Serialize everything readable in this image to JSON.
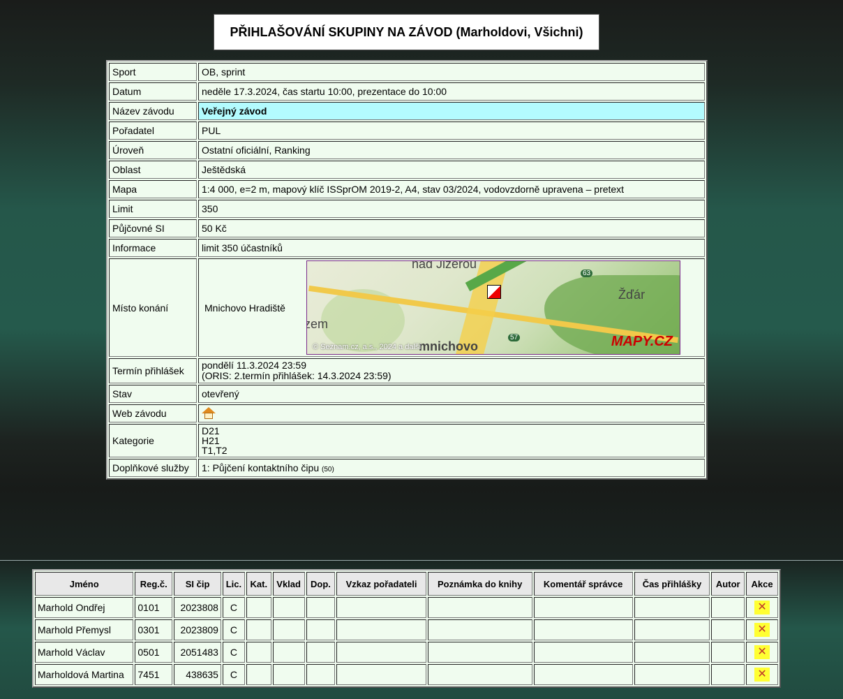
{
  "title": "PŘIHLAŠOVÁNÍ SKUPINY NA ZÁVOD (Marholdovi, Všichni)",
  "info": {
    "sport_label": "Sport",
    "sport": "OB, sprint",
    "datum_label": "Datum",
    "datum": "neděle 17.3.2024, čas startu 10:00, prezentace do 10:00",
    "nazev_label": "Název závodu",
    "nazev": "Veřejný závod",
    "poradatel_label": "Pořadatel",
    "poradatel": "PUL",
    "uroven_label": "Úroveň",
    "uroven": "Ostatní oficiální, Ranking",
    "oblast_label": "Oblast",
    "oblast": "Ještědská",
    "mapa_label": "Mapa",
    "mapa": "1:4 000, e=2 m, mapový klíč ISSprOM 2019-2, A4, stav 03/2024, vodovzdorně upravena – pretext",
    "limit_label": "Limit",
    "limit": "350",
    "si_label": "Půjčovné SI",
    "si": "50 Kč",
    "informace_label": "Informace",
    "informace": "limit 350 účastníků",
    "misto_label": "Místo konání",
    "misto": "Mnichovo Hradiště",
    "termin_label": "Termín přihlášek",
    "termin_line1": "pondělí 11.3.2024 23:59",
    "termin_line2": "(ORIS: 2.termín přihlášek: 14.3.2024 23:59)",
    "stav_label": "Stav",
    "stav": "otevřený",
    "web_label": "Web závodu",
    "kategorie_label": "Kategorie",
    "kategorie": [
      "D21",
      "H21",
      "T1,T2"
    ],
    "sluzby_label": "Doplňkové služby",
    "sluzby": "1: Půjčení kontaktního čipu",
    "sluzby_small": "(50)"
  },
  "map": {
    "label_top": "nad Jizerou",
    "label_left": "zem",
    "label_right": "Žďár",
    "label_bottom": "mnichovo",
    "road_63": "63",
    "road_57": "57",
    "copyright": "© Seznam.cz, a.s., 2024 a další",
    "brand": "MAPY.CZ"
  },
  "table": {
    "headers": [
      "Jméno",
      "Reg.č.",
      "SI čip",
      "Lic.",
      "Kat.",
      "Vklad",
      "Dop.",
      "Vzkaz pořadateli",
      "Poznámka do knihy",
      "Komentář správce",
      "Čas přihlášky",
      "Autor",
      "Akce"
    ],
    "rows": [
      {
        "name": "Marhold Ondřej",
        "reg": "0101",
        "si": "2023808",
        "lic": "C"
      },
      {
        "name": "Marhold Přemysl",
        "reg": "0301",
        "si": "2023809",
        "lic": "C"
      },
      {
        "name": "Marhold Václav",
        "reg": "0501",
        "si": "2051483",
        "lic": "C"
      },
      {
        "name": "Marholdová Martina",
        "reg": "7451",
        "si": "438635",
        "lic": "C"
      }
    ],
    "delete_glyph": "✕"
  },
  "icons": {
    "web": "home-icon",
    "delete": "delete-icon"
  },
  "colors": {
    "highlight": "#b3fbfe",
    "table_bg": "#f0fcef",
    "delete_bg": "#ffff33"
  }
}
